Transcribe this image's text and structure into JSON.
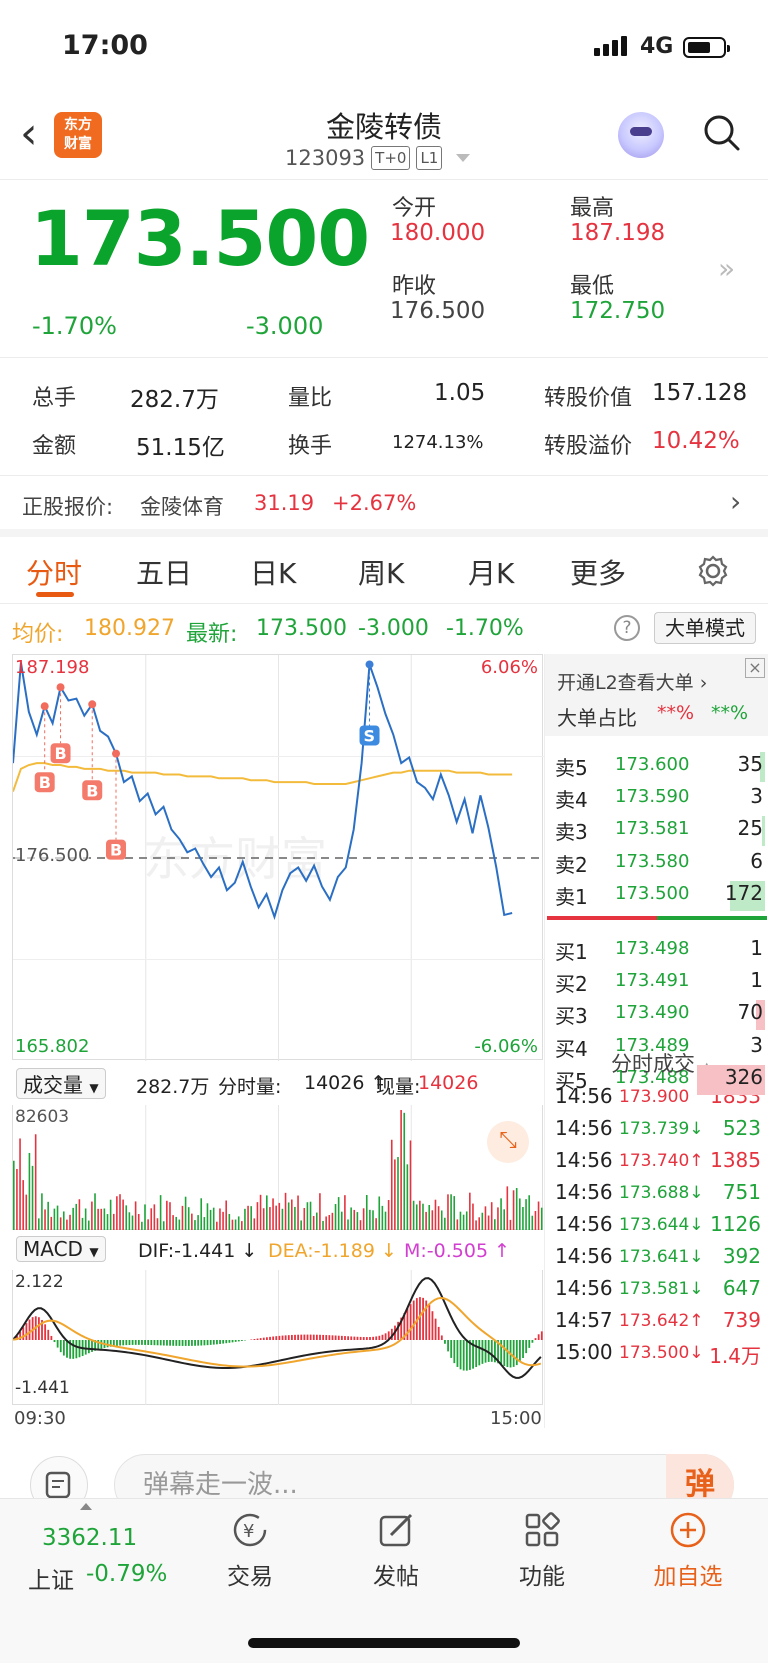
{
  "status_bar": {
    "time": "17:00",
    "network": "4G"
  },
  "header": {
    "logo_line1": "东方",
    "logo_line2": "财富",
    "title": "金陵转债",
    "code": "123093",
    "tag1": "T+0",
    "tag2": "L1"
  },
  "quote": {
    "price": "173.500",
    "change_pct": "-1.70%",
    "change": "-3.000",
    "open_label": "今开",
    "open": "180.000",
    "high_label": "最高",
    "high": "187.198",
    "prev_label": "昨收",
    "prev": "176.500",
    "low_label": "最低",
    "low": "172.750"
  },
  "stats": {
    "vol_label": "总手",
    "vol": "282.7万",
    "ratio_label": "量比",
    "ratio": "1.05",
    "conv_value_label": "转股价值",
    "conv_value": "157.128",
    "amount_label": "金额",
    "amount": "51.15亿",
    "turnover_label": "换手",
    "turnover": "1274.13%",
    "premium_label": "转股溢价",
    "premium": "10.42%"
  },
  "underlying": {
    "label": "正股报价:",
    "name": "金陵体育",
    "price": "31.19",
    "pct": "+2.67%"
  },
  "tabs": [
    "分时",
    "五日",
    "日K",
    "周K",
    "月K",
    "更多"
  ],
  "summary": {
    "avg_label": "均价:",
    "avg": "180.927",
    "last_label": "最新:",
    "last": "173.500",
    "chg": "-3.000",
    "pct": "-1.70%",
    "mode_button": "大单模式"
  },
  "chart_data": {
    "type": "line",
    "y_max_label": "187.198",
    "y_min_label": "165.802",
    "pct_max_label": "6.06%",
    "pct_min_label": "-6.06%",
    "base_label": "176.500",
    "watermark": "东方财富",
    "time_start": "09:30",
    "time_end": "15:00",
    "price_series": [
      181.5,
      186.8,
      184.2,
      183.0,
      184.5,
      183.6,
      185.5,
      184.8,
      184.9,
      184.0,
      184.6,
      183.2,
      182.9,
      182.0,
      180.5,
      180.8,
      179.5,
      179.9,
      178.8,
      179.2,
      178.0,
      177.5,
      176.8,
      177.0,
      176.2,
      175.5,
      176.0,
      174.8,
      175.2,
      176.3,
      175.0,
      173.9,
      174.6,
      173.4,
      174.8,
      175.7,
      176.0,
      175.3,
      176.1,
      175.0,
      174.3,
      175.5,
      176.0,
      178.0,
      181.5,
      186.7,
      185.5,
      184.1,
      183.0,
      181.5,
      181.8,
      180.5,
      180.2,
      179.6,
      180.9,
      179.8,
      178.4,
      179.6,
      177.8,
      179.8,
      178.1,
      176.0,
      173.5,
      173.6
    ],
    "avg_series": [
      180.0,
      181.2,
      181.4,
      181.5,
      181.5,
      181.4,
      181.4,
      181.3,
      181.3,
      181.2,
      181.2,
      181.2,
      181.1,
      181.1,
      181.1,
      181.0,
      181.0,
      181.0,
      181.0,
      180.9,
      180.9,
      180.9,
      180.8,
      180.8,
      180.8,
      180.8,
      180.7,
      180.7,
      180.7,
      180.7,
      180.6,
      180.6,
      180.6,
      180.5,
      180.5,
      180.5,
      180.5,
      180.5,
      180.4,
      180.4,
      180.4,
      180.4,
      180.4,
      180.5,
      180.6,
      180.7,
      180.8,
      180.9,
      181.0,
      181.0,
      181.1,
      181.1,
      181.1,
      181.1,
      181.1,
      181.1,
      181.0,
      181.0,
      181.0,
      181.0,
      180.9,
      180.9,
      180.9,
      180.9
    ],
    "markers": [
      {
        "label": "B"
      },
      {
        "label": "B"
      },
      {
        "label": "B"
      },
      {
        "label": "B"
      },
      {
        "label": "S"
      }
    ]
  },
  "volume": {
    "selector": "成交量",
    "total": "282.7万",
    "tick_label": "分时量:",
    "tick": "14026",
    "now_label": "现量:",
    "now": "14026",
    "max_label": "82603"
  },
  "macd": {
    "selector": "MACD",
    "dif": "DIF:-1.441",
    "dea": "DEA:-1.189",
    "m": "M:-0.505",
    "max_label": "2.122",
    "min_label": "-1.441"
  },
  "l2": {
    "promo": "开通L2查看大单",
    "ratio_label": "大单占比",
    "ratio_red": "**%",
    "ratio_green": "**%"
  },
  "orderbook": {
    "asks": [
      {
        "name": "卖5",
        "price": "173.600",
        "qty": "35",
        "w": 0.05
      },
      {
        "name": "卖4",
        "price": "173.590",
        "qty": "3",
        "w": 0.0
      },
      {
        "name": "卖3",
        "price": "173.581",
        "qty": "25",
        "w": 0.03
      },
      {
        "name": "卖2",
        "price": "173.580",
        "qty": "6",
        "w": 0.0
      },
      {
        "name": "卖1",
        "price": "173.500",
        "qty": "172",
        "w": 0.32
      }
    ],
    "bids": [
      {
        "name": "买1",
        "price": "173.498",
        "qty": "1",
        "w": 0.0
      },
      {
        "name": "买2",
        "price": "173.491",
        "qty": "1",
        "w": 0.0
      },
      {
        "name": "买3",
        "price": "173.490",
        "qty": "70",
        "w": 0.08
      },
      {
        "name": "买4",
        "price": "173.489",
        "qty": "3",
        "w": 0.0
      },
      {
        "name": "买5",
        "price": "173.488",
        "qty": "326",
        "w": 0.62
      }
    ]
  },
  "trades": {
    "title": "分时成交",
    "rows": [
      {
        "time": "14:56",
        "price": "173.900",
        "vol": "1833",
        "dir": "",
        "color": "red"
      },
      {
        "time": "14:56",
        "price": "173.739↓",
        "vol": "523",
        "dir": "",
        "color": "green"
      },
      {
        "time": "14:56",
        "price": "173.740↑",
        "vol": "1385",
        "dir": "",
        "color": "red"
      },
      {
        "time": "14:56",
        "price": "173.688↓",
        "vol": "751",
        "dir": "",
        "color": "green"
      },
      {
        "time": "14:56",
        "price": "173.644↓",
        "vol": "1126",
        "dir": "",
        "color": "green"
      },
      {
        "time": "14:56",
        "price": "173.641↓",
        "vol": "392",
        "dir": "",
        "color": "green"
      },
      {
        "time": "14:56",
        "price": "173.581↓",
        "vol": "647",
        "dir": "",
        "color": "green"
      },
      {
        "time": "14:57",
        "price": "173.642↑",
        "vol": "739",
        "dir": "",
        "color": "red"
      },
      {
        "time": "15:00",
        "price": "173.500↓",
        "vol": "1.4万",
        "dir": "",
        "color": "red"
      }
    ]
  },
  "comment_placeholder": "弹幕走一波...",
  "danmu_button": "弹",
  "bottom_nav": {
    "index_value": "3362.11",
    "index_name": "上证",
    "index_pct": "-0.79%",
    "items": [
      "交易",
      "发帖",
      "功能",
      "加自选"
    ]
  }
}
